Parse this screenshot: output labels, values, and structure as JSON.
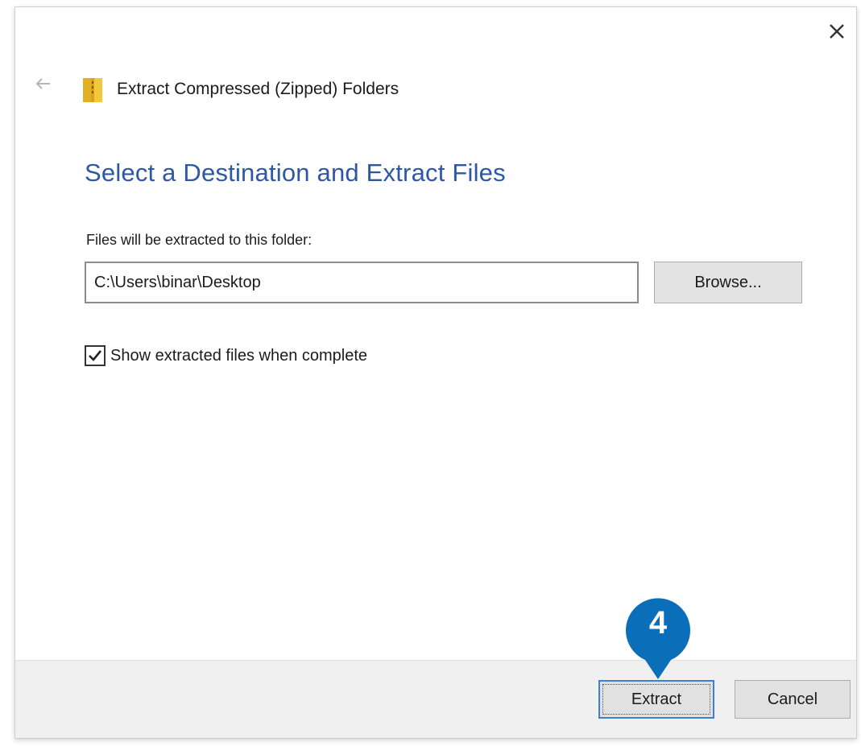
{
  "window": {
    "title": "Extract Compressed (Zipped) Folders",
    "close_icon": "close-icon",
    "back_icon": "back-arrow-icon",
    "folder_icon": "zip-folder-icon"
  },
  "main": {
    "heading": "Select a Destination and Extract Files",
    "destination_label": "Files will be extracted to this folder:",
    "destination_path": "C:\\Users\\binar\\Desktop",
    "browse_label": "Browse...",
    "show_files_label": "Show extracted files when complete",
    "show_files_checked": true
  },
  "footer": {
    "extract_label": "Extract",
    "cancel_label": "Cancel"
  },
  "annotation": {
    "step_number": "4",
    "color": "#0a6fb8"
  },
  "colors": {
    "heading": "#2e57a6",
    "footer_bg": "#f0f0f0",
    "focus_border": "#3c7fd6"
  }
}
